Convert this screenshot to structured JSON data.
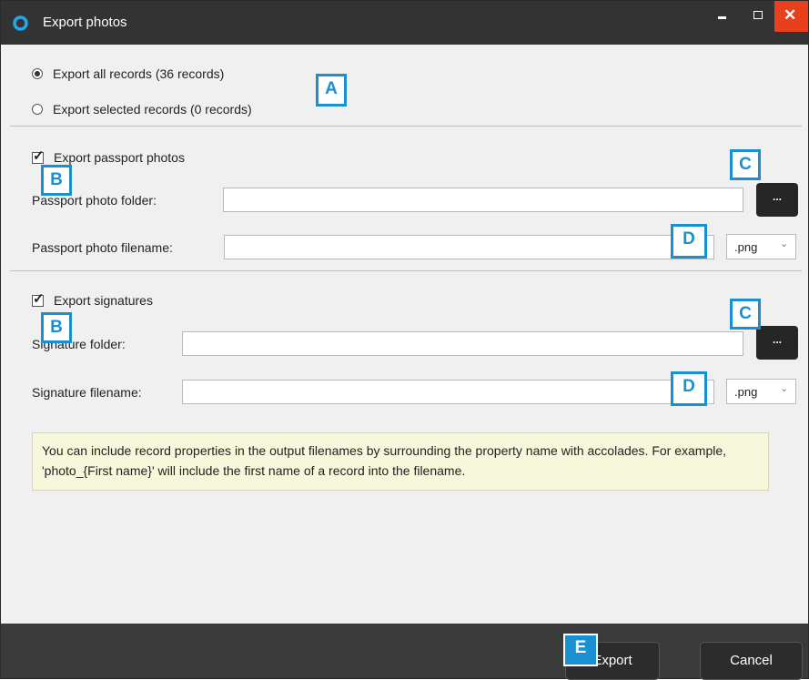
{
  "window": {
    "title": "Export photos",
    "controls": {
      "minimize_icon": "minimize-icon",
      "maximize_icon": "maximize-icon",
      "close_icon": "close-icon"
    }
  },
  "export_scope": {
    "options": [
      {
        "label": "Export all records (36 records)",
        "selected": true
      },
      {
        "label": "Export selected records (0 records)",
        "selected": false
      }
    ]
  },
  "passport": {
    "checkbox_label": "Export passport photos",
    "checked": true,
    "folder_label": "Passport photo folder:",
    "folder_value": "",
    "browse_label": "...",
    "filename_label": "Passport photo filename:",
    "filename_value": "",
    "format": ".png"
  },
  "signature": {
    "checkbox_label": "Export signatures",
    "checked": true,
    "folder_label": "Signature folder:",
    "folder_value": "",
    "browse_label": "...",
    "filename_label": "Signature filename:",
    "filename_value": "",
    "format": ".png"
  },
  "info_note": "You can include record properties in the output filenames by surrounding the property name with accolades. For example, 'photo_{First name}' will include the first name of a record into the filename.",
  "footer": {
    "export_label": "Export",
    "cancel_label": "Cancel"
  },
  "annotations": {
    "a": "A",
    "b": "B",
    "c": "C",
    "d": "D",
    "e": "E"
  },
  "colors": {
    "titlebar": "#333333",
    "close_button": "#e8401c",
    "annotation": "#1a8fd1",
    "note_bg": "#f7f7dc"
  }
}
